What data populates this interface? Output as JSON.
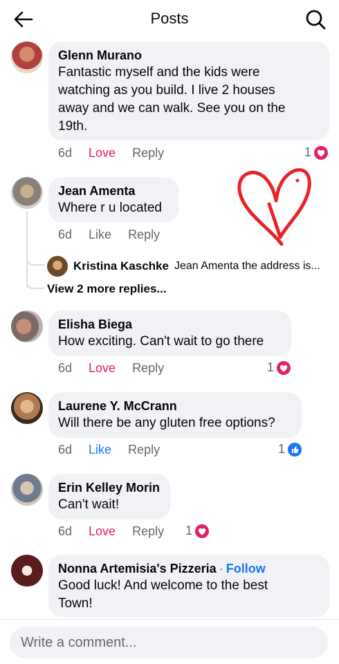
{
  "header": {
    "title": "Posts"
  },
  "comments": [
    {
      "author": "Glenn Murano",
      "lines": [
        "Fantastic myself and the kids were",
        "watching as you build. I live 2 houses",
        "away and we can walk. See you on the",
        "19th."
      ],
      "time": "6d",
      "action": "Love",
      "reply": "Reply",
      "reaction_count": "1",
      "reaction_type": "heart"
    },
    {
      "author": "Jean Amenta",
      "lines": [
        "Where r u located"
      ],
      "time": "6d",
      "action": "Like",
      "reply": "Reply"
    },
    {
      "author": "Elisha Biega",
      "lines": [
        "How exciting. Can't wait to go there"
      ],
      "time": "6d",
      "action": "Love",
      "reply": "Reply",
      "reaction_count": "1",
      "reaction_type": "heart"
    },
    {
      "author": "Laurene Y. McCrann",
      "lines": [
        "Will there be any gluten free options?"
      ],
      "time": "6d",
      "action": "Like",
      "reply": "Reply",
      "reaction_count": "1",
      "reaction_type": "like"
    },
    {
      "author": "Erin Kelley Morin",
      "lines": [
        "Can't wait!"
      ],
      "time": "6d",
      "action": "Love",
      "reply": "Reply",
      "reaction_count": "1",
      "reaction_type": "heart"
    },
    {
      "author": "Nonna Artemisia's Pizzeria",
      "follow": "Follow",
      "lines": [
        "Good luck! And welcome to the best",
        "Town!"
      ]
    }
  ],
  "reply_preview": {
    "author": "Kristina Kaschke",
    "text": "Jean Amenta the address is...",
    "more": "View 2 more replies..."
  },
  "footer": {
    "placeholder": "Write a comment..."
  },
  "colors": {
    "love": "#e0245e",
    "like": "#1877f2",
    "bubble": "#f0f2f5",
    "doodle": "#e8242a"
  }
}
